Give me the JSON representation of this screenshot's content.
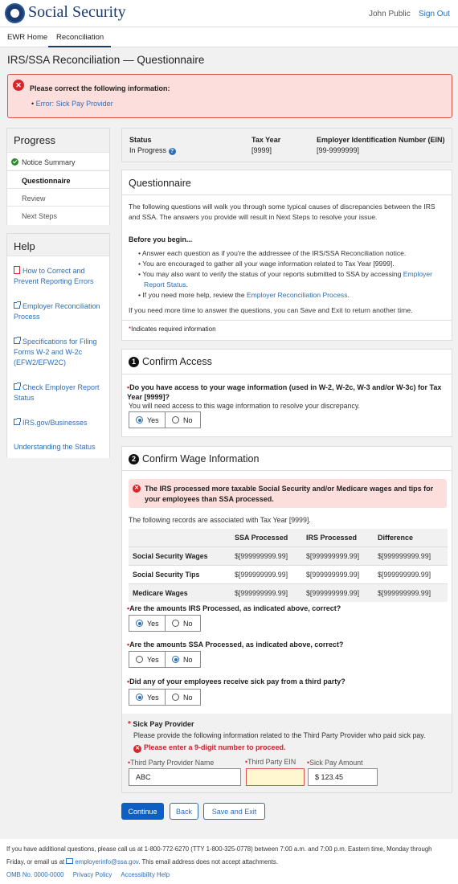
{
  "header": {
    "brand": "Social Security",
    "user": "John Public",
    "signout": "Sign Out"
  },
  "nav": {
    "items": [
      "EWR Home",
      "Reconciliation"
    ]
  },
  "page_title": "IRS/SSA Reconciliation — Questionnaire",
  "alert": {
    "title": "Please correct the following information:",
    "item": "Error: Sick Pay Provider"
  },
  "progress": {
    "heading": "Progress",
    "items": [
      "Notice Summary",
      "Questionnaire",
      "Review",
      "Next Steps"
    ]
  },
  "help": {
    "heading": "Help",
    "links": [
      "How to Correct and Prevent Reporting Errors",
      "Employer Reconciliation Process",
      "Specifications for Filing Forms W-2 and W-2c (EFW2/EFW2C)",
      "Check Employer Report Status",
      "IRS.gov/Businesses",
      "Understanding the Status"
    ]
  },
  "status": {
    "status_label": "Status",
    "status_value": "In Progress",
    "tax_year_label": "Tax Year",
    "tax_year_value": "[9999]",
    "ein_label": "Employer Identification Number (EIN)",
    "ein_value": "[99-9999999]"
  },
  "questionnaire": {
    "heading": "Questionnaire",
    "intro": "The following questions will walk you through some typical causes of discrepancies between the IRS and SSA. The answers you provide will result in Next Steps to resolve your issue.",
    "before": "Before you begin...",
    "b1": "Answer each question as if you're the addressee of the IRS/SSA Reconciliation notice.",
    "b2": "You are encouraged to gather all your wage information related to Tax Year [9999].",
    "b3": "You may also want to verify the status of your reports submitted to SSA by accessing ",
    "b3_link": "Employer Report Status",
    "b3_end": ".",
    "b4": "If you need more help, review the ",
    "b4_link": "Employer Reconciliation Process",
    "b4_end": ".",
    "more_time": "If you need more time to answer the questions, you can Save and Exit to return another time.",
    "required_note": "Indicates required information"
  },
  "confirm_access": {
    "number": "1",
    "heading": "Confirm Access",
    "question": "Do you have access to your wage information (used in W-2, W-2c, W-3 and/or W-3c) for Tax Year [9999]?",
    "hint": "You will need access to this wage information to resolve your discrepancy.",
    "yes": "Yes",
    "no": "No",
    "selected": "Yes"
  },
  "confirm_wage": {
    "number": "2",
    "heading": "Confirm Wage Information",
    "error": "The IRS processed more taxable Social Security and/or Medicare wages and tips for your employees than SSA processed.",
    "records_note": "The following records are associated with Tax Year [9999].",
    "table": {
      "headers": [
        "",
        "SSA Processed",
        "IRS Processed",
        "Difference"
      ],
      "rows": [
        [
          "Social Security Wages",
          "$[999999999.99]",
          "$[999999999.99]",
          "$[999999999.99]"
        ],
        [
          "Social Security Tips",
          "$[999999999.99]",
          "$[999999999.99]",
          "$[999999999.99]"
        ],
        [
          "Medicare Wages",
          "$[999999999.99]",
          "$[999999999.99]",
          "$[999999999.99]"
        ]
      ]
    },
    "q1": "Are the amounts IRS Processed, as indicated above, correct?",
    "q1_selected": "Yes",
    "q2": "Are the amounts SSA Processed, as indicated above, correct?",
    "q2_selected": "No",
    "q3": "Did any of your employees receive sick pay from a third party?",
    "q3_selected": "Yes",
    "yes": "Yes",
    "no": "No"
  },
  "sick_pay": {
    "heading": "Sick Pay Provider",
    "desc": "Please provide the following information related to the Third Party Provider who paid sick pay.",
    "error": "Please enter a 9-digit number to proceed.",
    "name_label": "Third Party Provider Name",
    "name_value": "ABC",
    "ein_label": "Third Party EIN",
    "ein_value": "",
    "amount_label": "Sick Pay Amount",
    "amount_value": "$ 123.45"
  },
  "buttons": {
    "continue": "Continue",
    "back": "Back",
    "save_exit": "Save and Exit"
  },
  "footer": {
    "line1": "If you have additional questions, please call us at 1-800-772-6270 (TTY 1-800-325-0778) between 7:00 a.m. and 7:00 p.m. Eastern time, Monday through",
    "line2a": "Friday, or email us at ",
    "email": "employerinfo@ssa.gov",
    "line2b": ". This email address does not accept attachments.",
    "omb": "OMB No. 0000-0000",
    "privacy": "Privacy Policy",
    "accessibility": "Accessibility Help"
  }
}
